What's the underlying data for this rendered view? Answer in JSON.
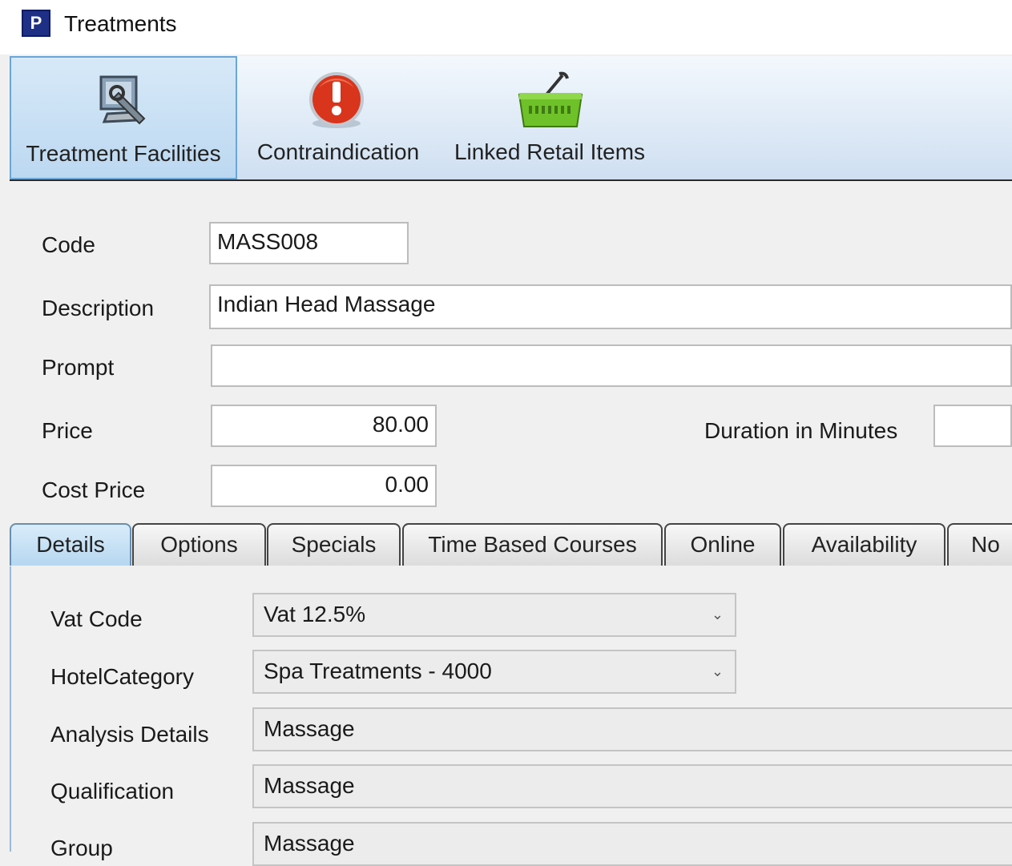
{
  "window": {
    "title": "Treatments",
    "app_icon_letter": "P"
  },
  "ribbon": {
    "buttons": [
      {
        "label": "Treatment Facilities",
        "icon": "monitor-tools-icon",
        "active": true
      },
      {
        "label": "Contraindication",
        "icon": "warning-exclamation-icon"
      },
      {
        "label": "Linked Retail Items",
        "icon": "shopping-basket-icon"
      }
    ]
  },
  "form": {
    "code": {
      "label": "Code",
      "value": "MASS008"
    },
    "description": {
      "label": "Description",
      "value": "Indian Head Massage"
    },
    "prompt": {
      "label": "Prompt",
      "value": ""
    },
    "price": {
      "label": "Price",
      "value": "80.00"
    },
    "duration": {
      "label": "Duration in Minutes",
      "value": ""
    },
    "cost_price": {
      "label": "Cost Price",
      "value": "0.00"
    }
  },
  "tabs": [
    {
      "label": "Details",
      "active": true
    },
    {
      "label": "Options"
    },
    {
      "label": "Specials"
    },
    {
      "label": "Time Based Courses"
    },
    {
      "label": "Online"
    },
    {
      "label": "Availability"
    },
    {
      "label": "No"
    }
  ],
  "details": {
    "vat_code": {
      "label": "Vat Code",
      "value": "Vat 12.5%"
    },
    "hotel_category": {
      "label": "HotelCategory",
      "value": "Spa Treatments - 4000"
    },
    "analysis_details": {
      "label": "Analysis Details",
      "value": "Massage"
    },
    "qualification": {
      "label": "Qualification",
      "value": "Massage"
    },
    "group": {
      "label": "Group",
      "value": "Massage"
    }
  },
  "colors": {
    "ribbon_active_border": "#6aa6d6",
    "tab_active": "#b6d7f0",
    "warning_red": "#d9341c",
    "basket_green": "#6fc12a"
  }
}
